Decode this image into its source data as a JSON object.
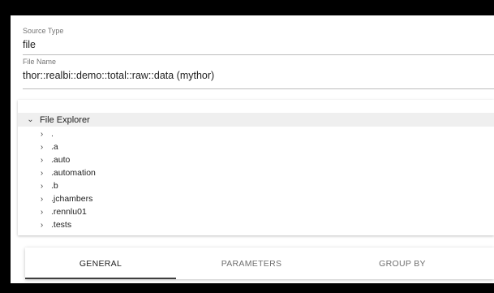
{
  "source_type": {
    "label": "Source Type",
    "value": "file"
  },
  "file_name": {
    "label": "File Name",
    "value": "thor::realbi::demo::total::raw::data (mythor)"
  },
  "explorer": {
    "root_label": "File Explorer",
    "items": [
      ".",
      ".a",
      ".auto",
      ".automation",
      ".b",
      ".jchambers",
      ".rennlu01",
      ".tests"
    ]
  },
  "tabs": [
    {
      "label": "GENERAL",
      "active": true
    },
    {
      "label": "PARAMETERS",
      "active": false
    },
    {
      "label": "GROUP BY",
      "active": false
    }
  ],
  "icons": {
    "expanded": "chevron-down-icon",
    "collapsed": "chevron-right-icon"
  }
}
